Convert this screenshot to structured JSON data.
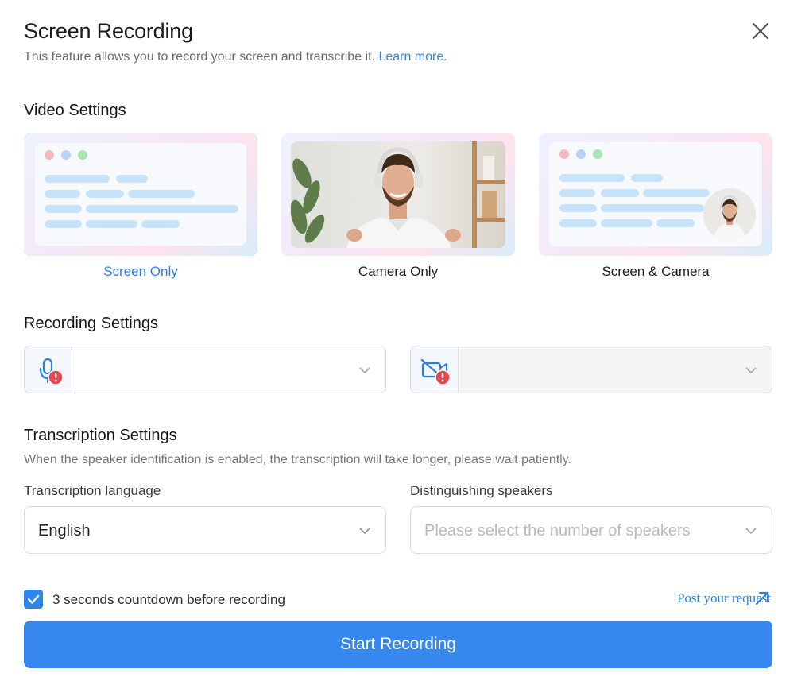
{
  "header": {
    "title": "Screen Recording",
    "subtitle": "This feature allows you to record your screen and transcribe it.",
    "learn_more": "Learn more."
  },
  "video_settings": {
    "heading": "Video Settings",
    "options": [
      {
        "label": "Screen Only",
        "selected": true
      },
      {
        "label": "Camera Only",
        "selected": false
      },
      {
        "label": "Screen & Camera",
        "selected": false
      }
    ]
  },
  "recording_settings": {
    "heading": "Recording Settings",
    "microphone": {
      "icon": "microphone-warning-icon",
      "value": ""
    },
    "camera": {
      "icon": "camera-off-warning-icon",
      "value": "",
      "disabled": true
    }
  },
  "transcription_settings": {
    "heading": "Transcription Settings",
    "description": "When the speaker identification is enabled, the transcription will take longer, please wait patiently.",
    "language_label": "Transcription language",
    "language_value": "English",
    "speakers_label": "Distinguishing speakers",
    "speakers_placeholder": "Please select the number of speakers"
  },
  "footer": {
    "countdown_label": "3 seconds countdown before recording",
    "countdown_checked": true,
    "post_request": "Post your request",
    "start_button": "Start Recording"
  },
  "colors": {
    "accent": "#2e86ea",
    "button": "#3688ee",
    "warning": "#e5484d"
  }
}
